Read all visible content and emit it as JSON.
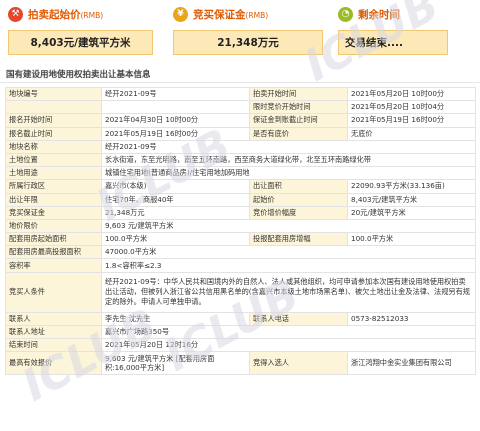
{
  "header": {
    "start_price": {
      "title": "拍卖起始价",
      "unit": "(RMB)",
      "value": "8,403元/建筑平方米",
      "icon": "gavel-icon",
      "icon_color": "#e8462b"
    },
    "deposit": {
      "title": "竞买保证金",
      "unit": "(RMB)",
      "value": "21,348万元",
      "icon": "money-bag-icon",
      "icon_color": "#e8a41b"
    },
    "remaining": {
      "title": "剩余时间",
      "value": "交易结束....",
      "icon": "clock-icon",
      "icon_color": "#9bbb21"
    }
  },
  "colors": {
    "accent": "#e05a00",
    "box_bg": "#fde9b8",
    "label_bg": "#fdf5d9"
  },
  "section_title": "国有建设用地使用权拍卖出让基本信息",
  "rows": [
    {
      "cells": [
        {
          "text": "地块编号",
          "type": "lbl"
        },
        {
          "text": "经开2021-09号",
          "type": "val"
        },
        {
          "text": "拍卖开始时间",
          "type": "lbl"
        },
        {
          "text": "2021年05月20日 10时00分",
          "type": "val"
        }
      ]
    },
    {
      "cells": [
        {
          "text": "",
          "type": "lbl"
        },
        {
          "text": "",
          "type": "val"
        },
        {
          "text": "限时竞价开始时间",
          "type": "lbl"
        },
        {
          "text": "2021年05月20日 10时04分",
          "type": "val"
        }
      ]
    },
    {
      "cells": [
        {
          "text": "报名开始时间",
          "type": "lbl"
        },
        {
          "text": "2021年04月30日 10时00分",
          "type": "val"
        },
        {
          "text": "保证金到账截止时间",
          "type": "lbl"
        },
        {
          "text": "2021年05月19日 16时00分",
          "type": "val"
        }
      ]
    },
    {
      "cells": [
        {
          "text": "报名截止时间",
          "type": "lbl"
        },
        {
          "text": "2021年05月19日 16时00分",
          "type": "val"
        },
        {
          "text": "是否有底价",
          "type": "lbl"
        },
        {
          "text": "无底价",
          "type": "val"
        }
      ]
    },
    {
      "cells": [
        {
          "text": "地块名称",
          "type": "lbl"
        },
        {
          "text": "经开2021-09号",
          "type": "val",
          "span": 3
        }
      ]
    },
    {
      "cells": [
        {
          "text": "土地位置",
          "type": "lbl"
        },
        {
          "text": "长水街道，东至光明路，南至五环南路，西至商务大道绿化带，北至五环南路绿化带",
          "type": "val",
          "span": 3
        }
      ]
    },
    {
      "cells": [
        {
          "text": "土地用途",
          "type": "lbl"
        },
        {
          "text": "城镇住宅用地(普通商品房)/住宅用地加码用地",
          "type": "val",
          "span": 3
        }
      ]
    },
    {
      "cells": [
        {
          "text": "所属行政区",
          "type": "lbl"
        },
        {
          "text": "嘉兴市(本级)",
          "type": "val"
        },
        {
          "text": "出让面积",
          "type": "lbl"
        },
        {
          "text": "22090.93平方米(33.136亩)",
          "type": "val"
        }
      ]
    },
    {
      "cells": [
        {
          "text": "出让年限",
          "type": "lbl"
        },
        {
          "text": "住宅70年、商服40年",
          "type": "val"
        },
        {
          "text": "起始价",
          "type": "lbl"
        },
        {
          "text": "8,403元/建筑平方米",
          "type": "val"
        }
      ]
    },
    {
      "cells": [
        {
          "text": "竞买保证金",
          "type": "lbl"
        },
        {
          "text": "21,348万元",
          "type": "val"
        },
        {
          "text": "竞价增价幅度",
          "type": "lbl"
        },
        {
          "text": "20元/建筑平方米",
          "type": "val"
        }
      ]
    },
    {
      "cells": [
        {
          "text": "地价限价",
          "type": "lbl"
        },
        {
          "text": "9,603 元/建筑平方米",
          "type": "val",
          "span": 3
        }
      ]
    },
    {
      "cells": [
        {
          "text": "配套用房起始面积",
          "type": "lbl"
        },
        {
          "text": "100.0平方米",
          "type": "val"
        },
        {
          "text": "投报配套用房增幅",
          "type": "lbl"
        },
        {
          "text": "100.0平方米",
          "type": "val"
        }
      ]
    },
    {
      "cells": [
        {
          "text": "配套用房最高投报面积",
          "type": "lbl"
        },
        {
          "text": "47000.0平方米",
          "type": "val",
          "span": 3
        }
      ]
    },
    {
      "cells": [
        {
          "text": "容积率",
          "type": "lbl"
        },
        {
          "text": "1.8<容积率≤2.3",
          "type": "val",
          "span": 3
        }
      ]
    },
    {
      "cells": [
        {
          "text": "竞买人条件",
          "type": "lbl",
          "tall": true
        },
        {
          "text": "经开2021-09号：中华人民共和国境内外的自然人、法人或其他组织，均可申请参加本次国有建设用地使用权拍卖出让活动，但被列入浙江省公共信用黑名单的(含嘉兴市本级土地市场黑名单)、被欠土地出让金及法律、法规另有规定的除外。申请人可单独申请。",
          "type": "val",
          "span": 3,
          "wrap": true,
          "tall": true
        }
      ]
    },
    {
      "cells": [
        {
          "text": "联系人",
          "type": "lbl"
        },
        {
          "text": "李先生 沈先生",
          "type": "val"
        },
        {
          "text": "联系人电话",
          "type": "lbl"
        },
        {
          "text": "0573-82512033",
          "type": "val"
        }
      ]
    },
    {
      "cells": [
        {
          "text": "联系人地址",
          "type": "lbl"
        },
        {
          "text": "嘉兴市广场路350号",
          "type": "val",
          "span": 3
        }
      ]
    },
    {
      "cells": [
        {
          "text": "结束时间",
          "type": "lbl"
        },
        {
          "text": "2021年05月20日 12时16分",
          "type": "val",
          "span": 3
        }
      ]
    },
    {
      "cells": [
        {
          "text": "最高有效报价",
          "type": "lbl",
          "mid": true
        },
        {
          "text": "9,603 元/建筑平方米 [配套用房面积:16,000平方米]",
          "type": "val",
          "wrap": true,
          "mid": true
        },
        {
          "text": "竞得入选人",
          "type": "lbl",
          "mid": true
        },
        {
          "text": "浙江鸿翔中金实业集团有限公司",
          "type": "val",
          "mid": true
        }
      ]
    }
  ],
  "watermark": "ICLUB"
}
